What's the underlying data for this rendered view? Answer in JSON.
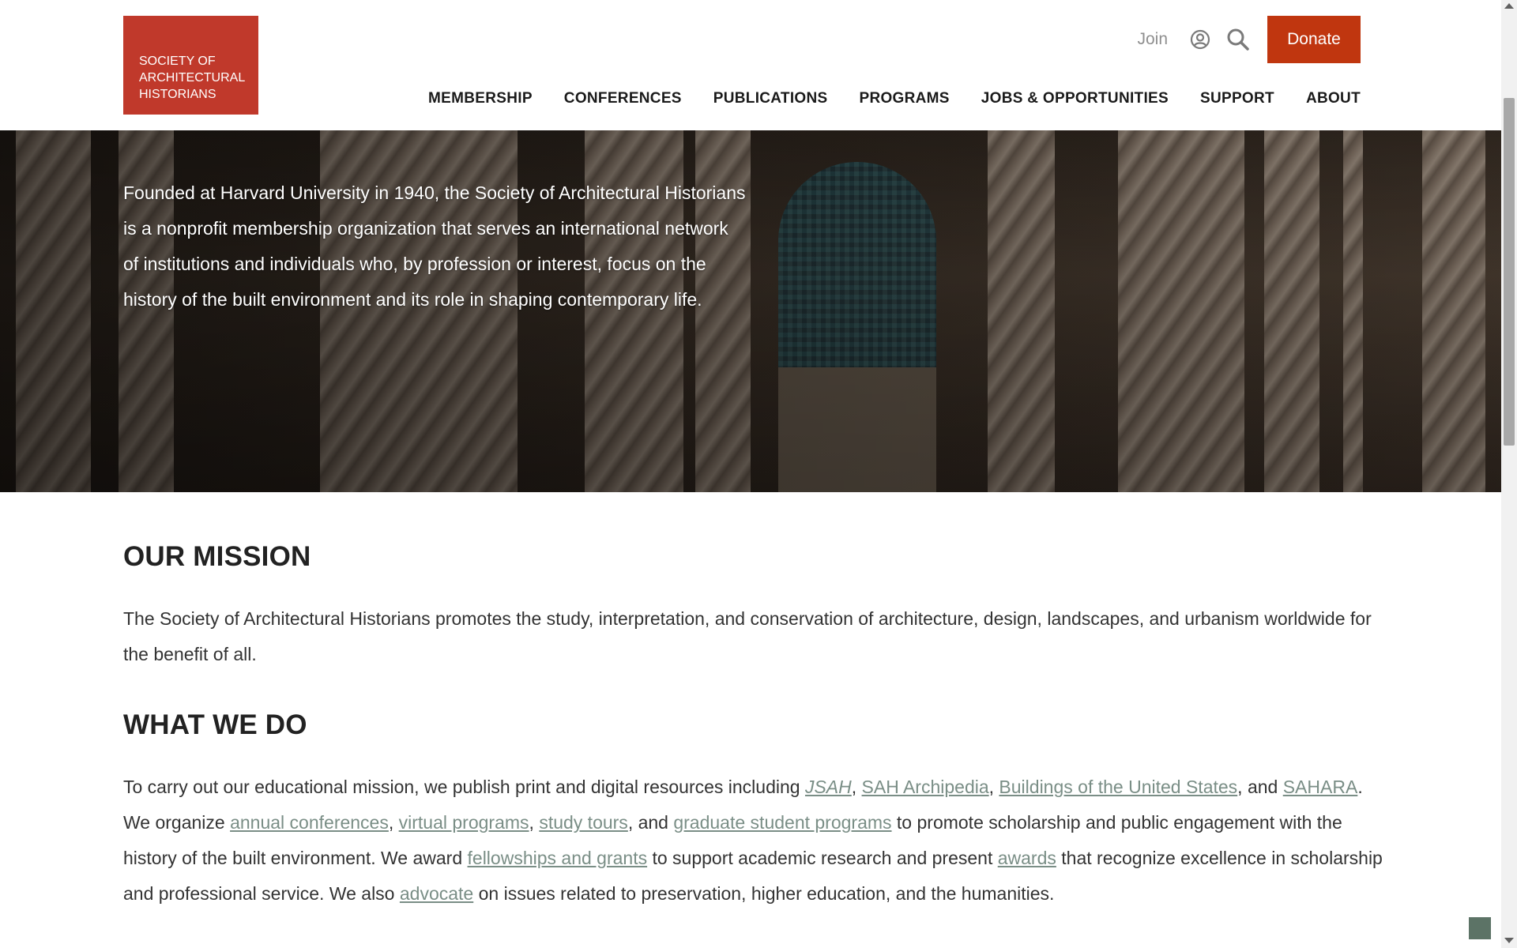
{
  "header": {
    "logo_lines": [
      "SOCIETY OF",
      "ARCHITECTURAL",
      "HISTORIANS"
    ],
    "join_label": "Join",
    "donate_label": "Donate",
    "nav": [
      "MEMBERSHIP",
      "CONFERENCES",
      "PUBLICATIONS",
      "PROGRAMS",
      "JOBS & OPPORTUNITIES",
      "SUPPORT",
      "ABOUT"
    ],
    "icons": [
      "user-icon",
      "search-icon"
    ]
  },
  "hero": {
    "text": "Founded at Harvard University in 1940, the Society of Architectural Historians is a nonprofit membership organization that serves an international network of institutions and individuals who, by profession or interest, focus on the history of the built environment and its role in shaping contemporary life."
  },
  "mission": {
    "heading": "OUR MISSION",
    "text": "The Society of Architectural Historians promotes the study, interpretation, and conservation of architecture, design, landscapes, and urbanism worldwide for the benefit of all."
  },
  "what_we_do": {
    "heading": "WHAT WE DO",
    "t1": "To carry out our educational mission, we publish print and digital resources including ",
    "link_jsah": "JSAH",
    "sep1": ", ",
    "link_archipedia": "SAH Archipedia",
    "sep2": ", ",
    "link_buildings": "Buildings of the United States",
    "t2": ", and ",
    "link_sahara": "SAHARA",
    "t3": ". We organize ",
    "link_conferences": "annual conferences",
    "sep3": ", ",
    "link_virtual": "virtual programs",
    "sep4": ", ",
    "link_tours": "study tours",
    "t4": ", and ",
    "link_graduate": "graduate student programs",
    "t5": " to promote scholarship and public engagement with the history of the built environment. We award ",
    "link_fellowships": "fellowships and grants",
    "t6": " to support academic research and present ",
    "link_awards": "awards",
    "t7": " that recognize excellence in scholarship and professional service. We also ",
    "link_advocate": "advocate",
    "t8": " on issues related to preservation, higher education, and the humanities."
  },
  "colors": {
    "brand_red": "#c0392b",
    "donate_red": "#c0360f",
    "link_gray_green": "#7a8e86"
  }
}
